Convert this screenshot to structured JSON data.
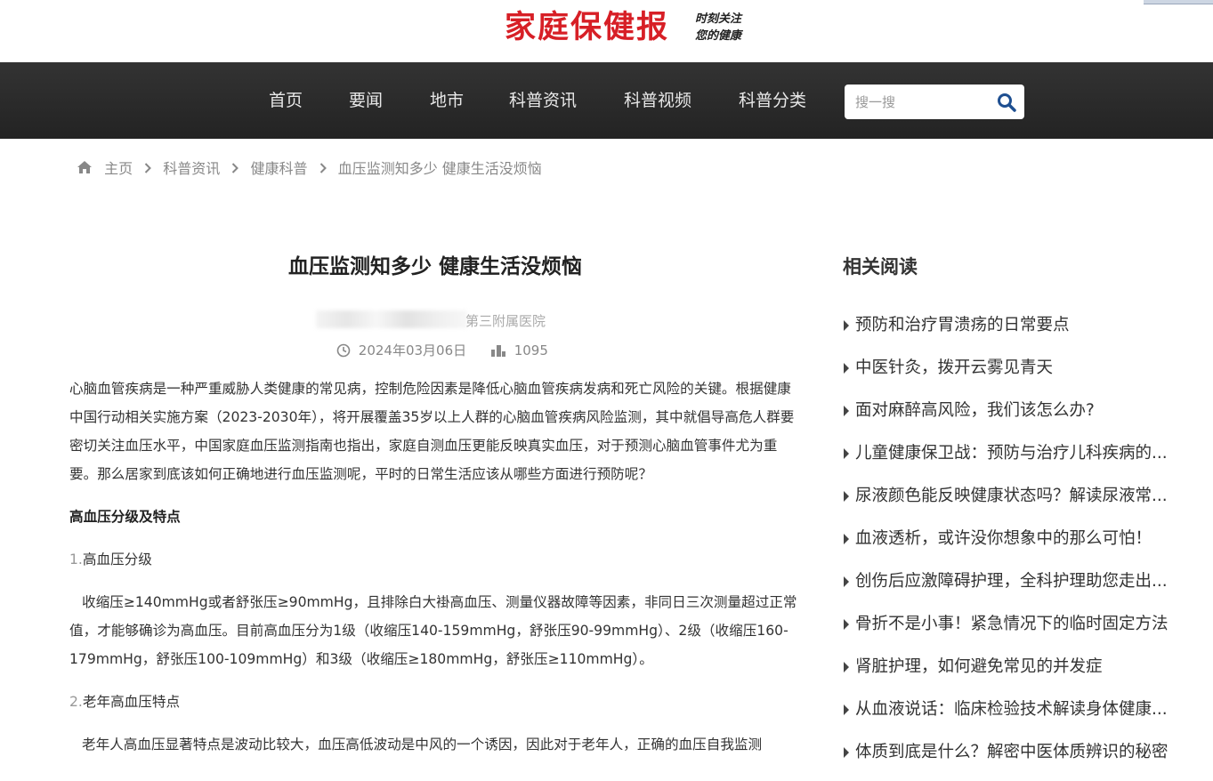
{
  "colors": {
    "brand_red": "#d71f26",
    "nav_bg": "#2b2b2b",
    "search_icon": "#1e4f91"
  },
  "header": {
    "logo_title": "家庭保健报",
    "slogan_line1": "时刻关注",
    "slogan_line2": "您的健康"
  },
  "nav": {
    "items": [
      "首页",
      "要闻",
      "地市",
      "科普资讯",
      "科普视频",
      "科普分类"
    ],
    "search_placeholder": "搜一搜",
    "search_icon": "search-icon"
  },
  "breadcrumb": {
    "home_icon": "home-icon",
    "items": [
      "主页",
      "科普资讯",
      "健康科普",
      "血压监测知多少 健康生活没烦恼"
    ]
  },
  "article": {
    "title": "血压监测知多少 健康生活没烦恼",
    "author_visible": "第三附属医院",
    "date": "2024年03月06日",
    "views": "1095",
    "intro": "心脑血管疾病是一种严重威胁人类健康的常见病，控制危险因素是降低心脑血管疾病发病和死亡风险的关键。根据健康中国行动相关实施方案（2023-2030年），将开展覆盖35岁以上人群的心脑血管疾病风险监测，其中就倡导高危人群要密切关注血压水平，中国家庭血压监测指南也指出，家庭自测血压更能反映真实血压，对于预测心脑血管事件尤为重要。那么居家到底该如何正确地进行血压监测呢，平时的日常生活应该从哪些方面进行预防呢？",
    "section1_heading": "高血压分级及特点",
    "sub1_num": "1.",
    "sub1_title": "高血压分级",
    "para1": "收缩压≥140mmHg或者舒张压≥90mmHg，且排除白大褂高血压、测量仪器故障等因素，非同日三次测量超过正常值，才能够确诊为高血压。目前高血压分为1级（收缩压140-159mmHg，舒张压90-99mmHg）、2级（收缩压160-179mmHg，舒张压100-109mmHg）和3级（收缩压≥180mmHg，舒张压≥110mmHg）。",
    "sub2_num": "2.",
    "sub2_title": "老年高血压特点",
    "para2": "老年人高血压显著特点是波动比较大，血压高低波动是中风的一个诱因，因此对于老年人，正确的血压自我监测"
  },
  "sidebar": {
    "title": "相关阅读",
    "items": [
      "预防和治疗胃溃疡的日常要点",
      "中医针灸，拨开云雾见青天",
      "面对麻醉高风险，我们该怎么办?",
      "儿童健康保卫战：预防与治疗儿科疾病的...",
      "尿液颜色能反映健康状态吗？解读尿液常...",
      "血液透析，或许没你想象中的那么可怕！",
      "创伤后应激障碍护理，全科护理助您走出...",
      "骨折不是小事！紧急情况下的临时固定方法",
      "肾脏护理，如何避免常见的并发症",
      "从血液说话：临床检验技术解读身体健康...",
      "体质到底是什么？解密中医体质辨识的秘密"
    ]
  }
}
